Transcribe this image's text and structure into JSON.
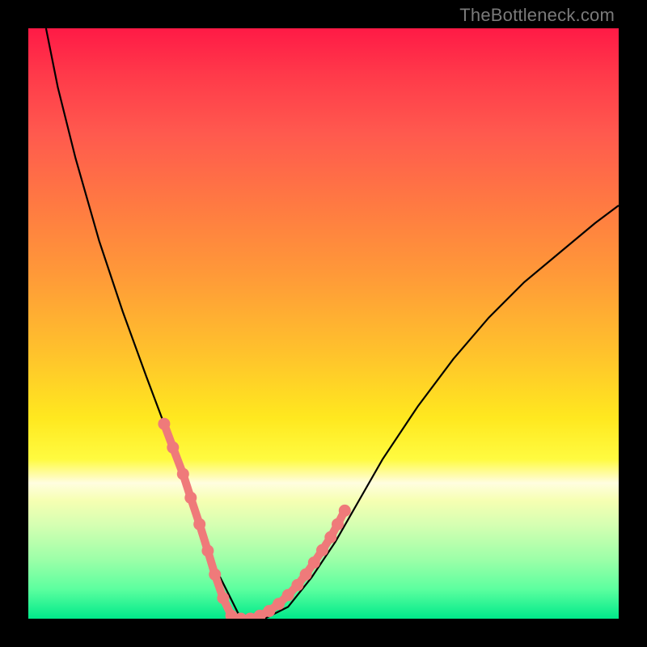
{
  "attribution": "TheBottleneck.com",
  "chart_data": {
    "type": "line",
    "title": "",
    "xlabel": "",
    "ylabel": "",
    "xlim": [
      0,
      100
    ],
    "ylim": [
      0,
      100
    ],
    "grid": false,
    "legend": false,
    "background_gradient": {
      "direction": "vertical",
      "stops": [
        {
          "pos": 0,
          "color": "#ff1a46"
        },
        {
          "pos": 50,
          "color": "#ffd21f"
        },
        {
          "pos": 77,
          "color": "#fffde0"
        },
        {
          "pos": 100,
          "color": "#00e98a"
        }
      ]
    },
    "series": [
      {
        "name": "curve",
        "color": "#000000",
        "x": [
          3,
          5,
          8,
          12,
          16,
          20,
          23,
          26,
          28,
          30,
          32,
          34,
          36,
          40,
          44,
          48,
          52,
          56,
          60,
          66,
          72,
          78,
          84,
          90,
          96,
          100
        ],
        "y": [
          100,
          90,
          78,
          64,
          52,
          41,
          33,
          25,
          19,
          13,
          8,
          4,
          0,
          0,
          2,
          7,
          13,
          20,
          27,
          36,
          44,
          51,
          57,
          62,
          67,
          70
        ]
      },
      {
        "name": "highlight-left",
        "color": "#ef7a7a",
        "markers": true,
        "x": [
          23,
          24.5,
          26.2,
          27.5,
          29,
          30.4,
          31.6,
          33,
          34.4
        ],
        "y": [
          33,
          29,
          24.5,
          20.5,
          16,
          11.5,
          7.5,
          3.5,
          0.5
        ]
      },
      {
        "name": "highlight-right",
        "color": "#ef7a7a",
        "markers": true,
        "x": [
          36,
          37.6,
          39.2,
          40.8,
          42.4,
          44,
          45.6,
          47,
          48.4,
          49.8,
          51.2,
          52.4,
          53.6
        ],
        "y": [
          0,
          0,
          0.5,
          1.3,
          2.5,
          4,
          5.7,
          7.5,
          9.5,
          11.6,
          13.8,
          16,
          18.3
        ]
      }
    ],
    "annotations": []
  }
}
